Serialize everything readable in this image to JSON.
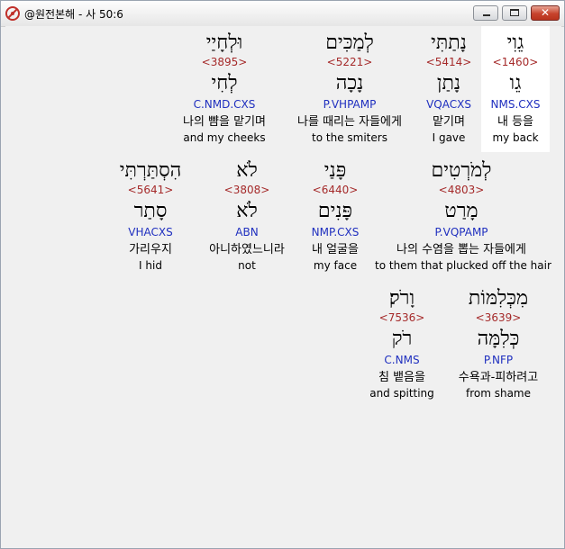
{
  "window": {
    "title": "@원전본해 - 사 50:6",
    "minimize_label": "",
    "maximize_label": "",
    "close_label": "✕"
  },
  "words": [
    {
      "hebrew": "גֵוִי",
      "strong": "<1460>",
      "lemma": "גֵו",
      "morph": "NMS.CXS",
      "korean": "내 등을",
      "english": "my back",
      "highlighted": true
    },
    {
      "hebrew": "נָתַתִּי",
      "strong": "<5414>",
      "lemma": "נָתַן",
      "morph": "VQACXS",
      "korean": "맡기며",
      "english": "I gave",
      "highlighted": false
    },
    {
      "hebrew": "לְמַכִּים",
      "strong": "<5221>",
      "lemma": "נָכָה",
      "morph": "P.VHPAMP",
      "korean": "나를 때리는 자들에게",
      "english": "to the smiters",
      "highlighted": false
    },
    {
      "hebrew": "וּלְחָיַי",
      "strong": "<3895>",
      "lemma": "לְחִי",
      "morph": "C.NMD.CXS",
      "korean": "나의 뺨을 맡기며",
      "english": "and my cheeks",
      "highlighted": false
    },
    {
      "hebrew": "לְמֹרְטִים",
      "strong": "<4803>",
      "lemma": "מָרַט",
      "morph": "P.VQPAMP",
      "korean": "나의 수염을 뽑는 자들에게",
      "english": "to them that plucked off the hair",
      "highlighted": false
    },
    {
      "hebrew": "פָּנַי",
      "strong": "<6440>",
      "lemma": "פָּנִים",
      "morph": "NMP.CXS",
      "korean": "내 얼굴을",
      "english": "my face",
      "highlighted": false
    },
    {
      "hebrew": "לֹא",
      "strong": "<3808>",
      "lemma": "לֹא",
      "morph": "ABN",
      "korean": "아니하였느니라",
      "english": "not",
      "highlighted": false
    },
    {
      "hebrew": "הִסְתַּרְתִּי",
      "strong": "<5641>",
      "lemma": "סָתַר",
      "morph": "VHACXS",
      "korean": "가리우지",
      "english": "I hid",
      "highlighted": false
    },
    {
      "hebrew": "מִכְּלִמּוֹת",
      "strong": "<3639>",
      "lemma": "כְּלִמָּה",
      "morph": "P.NFP",
      "korean": "수욕과-피하려고",
      "english": "from shame",
      "highlighted": false
    },
    {
      "hebrew": "וָרֹק׃",
      "strong": "<7536>",
      "lemma": "רֹק",
      "morph": "C.NMS",
      "korean": "침 뱉음을",
      "english": "and spitting",
      "highlighted": false
    }
  ],
  "colors": {
    "strong": "#a52a2a",
    "morph": "#1f2fbf",
    "highlight": "#ffffff",
    "background": "#f0f0f0"
  }
}
